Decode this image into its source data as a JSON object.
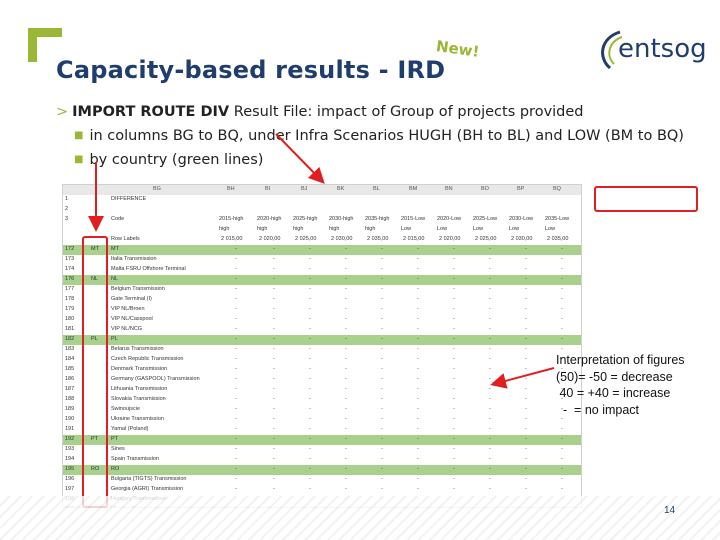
{
  "slide": {
    "title": "Capacity-based results - IRD",
    "new_badge": "New!",
    "logo_text": "entsog",
    "page_number": "14"
  },
  "bullets": {
    "level1_prefix": "IMPORT ROUTE DIV",
    "level1_rest": " Result File: impact of Group of projects provided",
    "level2_a": "in columns BG to BQ, under Infra Scenarios HUGH (BH to BL) and LOW (BM to BQ)",
    "level2_b": "by country (green lines)"
  },
  "interpretation": {
    "text": "Interpretation of figures\n(50)= -50 = decrease\n 40 = +40 = increase\n  -  = no impact"
  },
  "spreadsheet": {
    "col_letters": [
      "BG",
      "BH",
      "BI",
      "BJ",
      "BK",
      "BL",
      "BM",
      "BN",
      "BO",
      "BP",
      "BQ"
    ],
    "difference_label": "DIFFERENCE",
    "code_label": "Code",
    "row_labels_label": "Row Labels",
    "scenarios": [
      "2015-high",
      "2020-high",
      "2025-high",
      "2030-high",
      "2035-high",
      "2015-Low",
      "2020-Low",
      "2025-Low",
      "2030-Low",
      "2035-Low"
    ],
    "years": [
      "2 015,00",
      "2 020,00",
      "2 025,00",
      "2 030,00",
      "2 035,00",
      "2 015,00",
      "2 020,00",
      "2 025,00",
      "2 030,00",
      "2 035,00"
    ],
    "rows": [
      {
        "num": "172",
        "code": "MT",
        "label": "MT",
        "green": true
      },
      {
        "num": "173",
        "code": "",
        "label": "Italia Transmission",
        "green": false
      },
      {
        "num": "174",
        "code": "",
        "label": "Malta FSRU Offshore Terminal",
        "green": false
      },
      {
        "num": "176",
        "code": "NL",
        "label": "NL",
        "green": true
      },
      {
        "num": "177",
        "code": "",
        "label": "Belgium Transmission",
        "green": false
      },
      {
        "num": "178",
        "code": "",
        "label": "Gate Terminal (I)",
        "green": false
      },
      {
        "num": "179",
        "code": "",
        "label": "VIP NL/Broen",
        "green": false
      },
      {
        "num": "180",
        "code": "",
        "label": "VIP NL/Casspool",
        "green": false
      },
      {
        "num": "181",
        "code": "",
        "label": "VIP NL/NCG",
        "green": false
      },
      {
        "num": "182",
        "code": "PL",
        "label": "PL",
        "green": true
      },
      {
        "num": "183",
        "code": "",
        "label": "Belarus Transmission",
        "green": false
      },
      {
        "num": "184",
        "code": "",
        "label": "Czech Republic Transmission",
        "green": false
      },
      {
        "num": "185",
        "code": "",
        "label": "Denmark Transmission",
        "green": false
      },
      {
        "num": "186",
        "code": "",
        "label": "Germany (GASPOOL) Transmission",
        "green": false
      },
      {
        "num": "187",
        "code": "",
        "label": "Lithuania Transmission",
        "green": false
      },
      {
        "num": "188",
        "code": "",
        "label": "Slovakia Transmission",
        "green": false
      },
      {
        "num": "189",
        "code": "",
        "label": "Swinoujscie",
        "green": false
      },
      {
        "num": "190",
        "code": "",
        "label": "Ukraine Transmission",
        "green": false
      },
      {
        "num": "191",
        "code": "",
        "label": "Yamal (Poland)",
        "green": false
      },
      {
        "num": "192",
        "code": "PT",
        "label": "PT",
        "green": true
      },
      {
        "num": "193",
        "code": "",
        "label": "Sines",
        "green": false
      },
      {
        "num": "194",
        "code": "",
        "label": "Spain Transmission",
        "green": false
      },
      {
        "num": "195",
        "code": "RO",
        "label": "RO",
        "green": true
      },
      {
        "num": "196",
        "code": "",
        "label": "Bulgaria (TIGTS) Transmission",
        "green": false
      },
      {
        "num": "197",
        "code": "",
        "label": "Georgia (AGRI) Transmission",
        "green": false
      },
      {
        "num": "198",
        "code": "",
        "label": "Hungary Transmission",
        "green": false
      },
      {
        "num": "199",
        "code": "",
        "label": "Ukraine Transmission",
        "green": false
      }
    ],
    "cell_value": "-"
  }
}
